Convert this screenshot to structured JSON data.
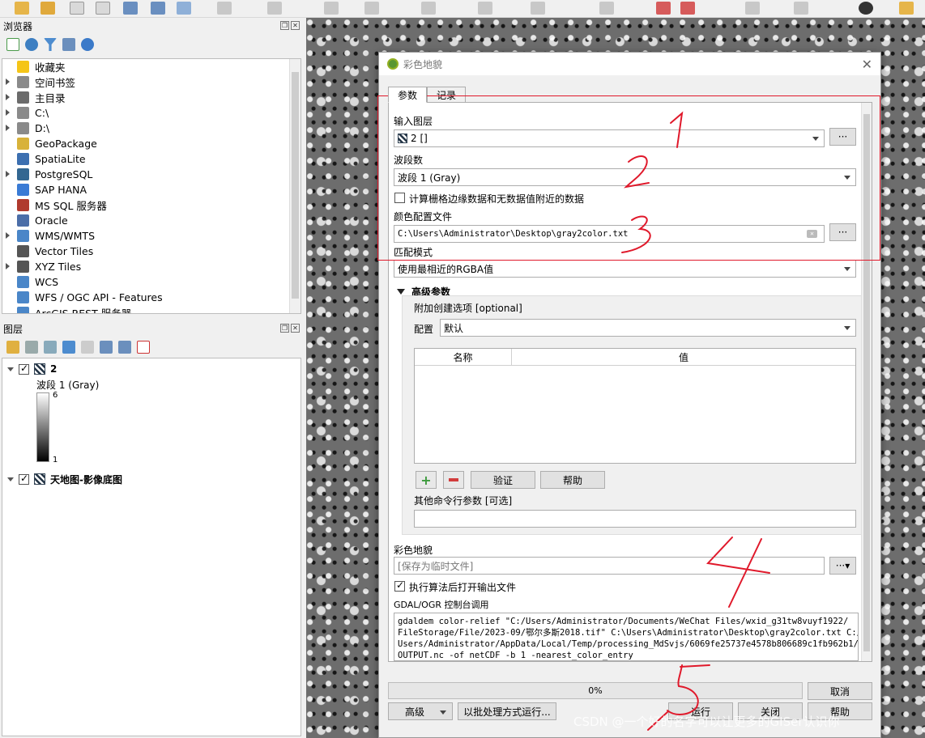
{
  "browser_panel": {
    "title": "浏览器",
    "items": [
      {
        "label": "收藏夹",
        "icon": "star-icon",
        "color": "#f5c518",
        "expandable": false
      },
      {
        "label": "空间书签",
        "icon": "bookmark-icon",
        "color": "#8a8a8a",
        "expandable": true
      },
      {
        "label": "主目录",
        "icon": "home-icon",
        "color": "#6b6b6b",
        "expandable": true
      },
      {
        "label": "C:\\",
        "icon": "drive-icon",
        "color": "#8a8a8a",
        "expandable": true
      },
      {
        "label": "D:\\",
        "icon": "drive-icon",
        "color": "#8a8a8a",
        "expandable": true
      },
      {
        "label": "GeoPackage",
        "icon": "geopackage-icon",
        "color": "#d8b23a",
        "expandable": false
      },
      {
        "label": "SpatiaLite",
        "icon": "spatialite-icon",
        "color": "#3c6fb0",
        "expandable": false
      },
      {
        "label": "PostgreSQL",
        "icon": "postgresql-icon",
        "color": "#336791",
        "expandable": true
      },
      {
        "label": "SAP HANA",
        "icon": "sap-hana-icon",
        "color": "#3a7bd5",
        "expandable": false
      },
      {
        "label": "MS SQL 服务器",
        "icon": "mssql-icon",
        "color": "#b03a2e",
        "expandable": false
      },
      {
        "label": "Oracle",
        "icon": "oracle-icon",
        "color": "#4b6ea8",
        "expandable": false
      },
      {
        "label": "WMS/WMTS",
        "icon": "globe-icon",
        "color": "#4a86c8",
        "expandable": true
      },
      {
        "label": "Vector Tiles",
        "icon": "grid-icon",
        "color": "#555555",
        "expandable": false
      },
      {
        "label": "XYZ Tiles",
        "icon": "tiles-icon",
        "color": "#555555",
        "expandable": true
      },
      {
        "label": "WCS",
        "icon": "globe-icon",
        "color": "#4a86c8",
        "expandable": false
      },
      {
        "label": "WFS / OGC API - Features",
        "icon": "wfs-icon",
        "color": "#4a86c8",
        "expandable": false
      },
      {
        "label": "ArcGIS REST 服务器",
        "icon": "arcgis-icon",
        "color": "#4a86c8",
        "expandable": false
      }
    ]
  },
  "layers_panel": {
    "title": "图层",
    "layers": [
      {
        "name": "2",
        "checked": true,
        "expanded": true,
        "band": "波段 1 (Gray)",
        "ramp_max": "6",
        "ramp_min": "1"
      },
      {
        "name": "天地图-影像底图",
        "checked": true,
        "expanded": true
      }
    ]
  },
  "dialog": {
    "title": "彩色地貌",
    "tabs": [
      "参数",
      "记录"
    ],
    "input_layer_label": "输入图层",
    "input_layer_value": "2 []",
    "band_label": "波段数",
    "band_value": "波段 1 (Gray)",
    "compute_edges_label": "计算栅格边缘数据和无数据值附近的数据",
    "compute_edges_checked": false,
    "color_file_label": "颜色配置文件",
    "color_file_value": "C:\\Users\\Administrator\\Desktop\\gray2color.txt",
    "match_mode_label": "匹配模式",
    "match_mode_value": "使用最相近的RGBA值",
    "advanced_label": "高级参数",
    "creation_options_label": "附加创建选项 [optional]",
    "profile_label": "配置",
    "profile_value": "默认",
    "table_headers": [
      "名称",
      "值"
    ],
    "validate_label": "验证",
    "help_small_label": "帮助",
    "extra_cmd_label": "其他命令行参数 [可选]",
    "extra_cmd_value": "",
    "output_label": "彩色地貌",
    "output_placeholder": "[保存为临时文件]",
    "open_output_label": "执行算法后打开输出文件",
    "open_output_checked": true,
    "console_label": "GDAL/OGR 控制台调用",
    "console_text": "gdaldem color-relief \"C:/Users/Administrator/Documents/WeChat Files/wxid_g31tw8vuyf1922/\nFileStorage/File/2023-09/鄂尔多斯2018.tif\" C:\\Users\\Administrator\\Desktop\\gray2color.txt C:/\nUsers/Administrator/AppData/Local/Temp/processing_MdSvjs/6069fe25737e4578b806689c1fb962b1/\nOUTPUT.nc -of netCDF -b 1 -nearest_color_entry",
    "progress_percent": 0,
    "progress_text": "0%",
    "cancel_label": "取消",
    "advanced_button_label": "高级",
    "batch_label": "以批处理方式运行...",
    "run_label": "运行",
    "close_label": "关闭",
    "help_label": "帮助"
  },
  "colors": {
    "annotation_red": "#e0192b",
    "qgis_green": "#589632"
  },
  "watermark": "CSDN @一个好的名字可以让更多的GISer认识你"
}
